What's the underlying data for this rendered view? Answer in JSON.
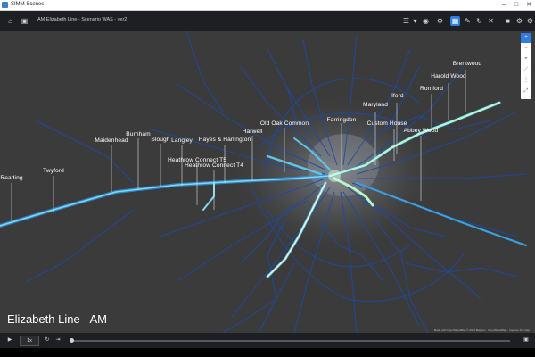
{
  "window": {
    "app_title": "SIMM Scenes",
    "minimize": "–",
    "maximize": "□",
    "close": "✕"
  },
  "toolbar": {
    "home_icon": "⌂",
    "save_icon": "▣",
    "scenario_title": "AM Elizabeth Line - Scenario WAS - ver2",
    "list_icon": "☰",
    "dropdown_icon": "▾",
    "target_icon": "◉",
    "settings_icon": "⚙",
    "layers_icon": "▦",
    "edit_icon": "✎",
    "refresh_icon": "↻",
    "close_icon": "✕",
    "camera_icon": "■",
    "gear_icon": "⚙",
    "gear2_icon": "⚙"
  },
  "map": {
    "caption": "Elizabeth Line - AM",
    "attribution": "Made with OpenStreetMap © 2024 Mapbox · OpenStreetMap · Improve this map",
    "labels": [
      {
        "id": "reading",
        "text": "Reading"
      },
      {
        "id": "twyford",
        "text": "Twyford"
      },
      {
        "id": "maidenhead",
        "text": "Maidenhead"
      },
      {
        "id": "burnham",
        "text": "Burnham"
      },
      {
        "id": "slough",
        "text": "Slough"
      },
      {
        "id": "langley",
        "text": "Langley"
      },
      {
        "id": "heathrow-connect-t5",
        "text": "Heathrow Connect T5"
      },
      {
        "id": "heathrow-connect-t4",
        "text": "Heathrow Connect T4"
      },
      {
        "id": "hayes-harlington",
        "text": "Hayes & Harlington"
      },
      {
        "id": "harwell",
        "text": "Harwell"
      },
      {
        "id": "old-oak-common",
        "text": "Old Oak Common"
      },
      {
        "id": "farringdon",
        "text": "Farringdon"
      },
      {
        "id": "maryland",
        "text": "Maryland"
      },
      {
        "id": "ilford",
        "text": "Ilford"
      },
      {
        "id": "custom-house",
        "text": "Custom House"
      },
      {
        "id": "abbey-wood",
        "text": "Abbey Wood"
      },
      {
        "id": "romford",
        "text": "Romford"
      },
      {
        "id": "harold-wood",
        "text": "Harold Wood"
      },
      {
        "id": "brentwood",
        "text": "Brentwood"
      }
    ],
    "tools": {
      "zoom_in": "+",
      "zoom_out": "−",
      "compass": "⌖",
      "measure": "⟋",
      "grid": "⋮",
      "reset": "⤢"
    }
  },
  "footer": {
    "play_icon": "▶",
    "speed_value": "1x",
    "loop_icon": "↻",
    "step_icon": "⇥",
    "fullscreen_icon": "▣",
    "progress": 0.0
  },
  "colors": {
    "accent": "#2f7de1",
    "map_bg": "#3b3b3b",
    "network_blue": "#1f4fb0",
    "highlight_cyan": "#7fd8f0",
    "highlight_green": "#b8f5c8"
  }
}
